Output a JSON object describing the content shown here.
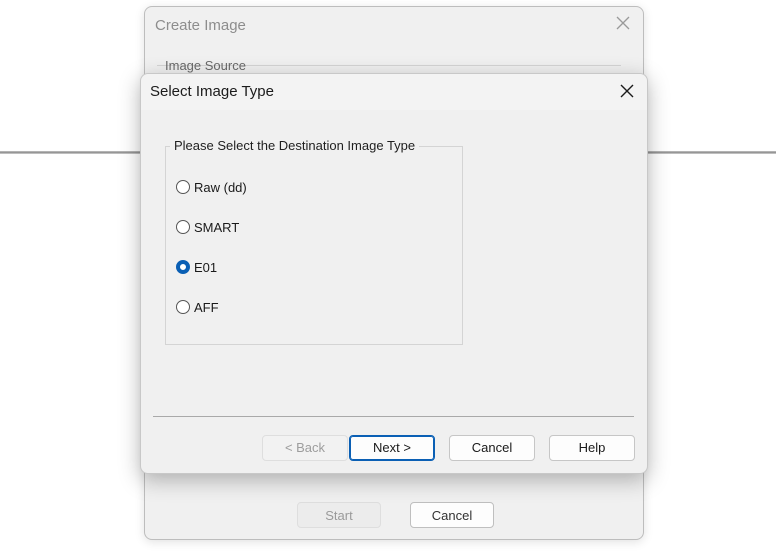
{
  "background_dialog": {
    "title": "Create Image",
    "section_label": "Image Source",
    "start_label": "Start",
    "cancel_label": "Cancel"
  },
  "dialog": {
    "title": "Select Image Type",
    "group_label": "Please Select the Destination Image Type",
    "options": [
      {
        "label": "Raw (dd)",
        "checked": false
      },
      {
        "label": "SMART",
        "checked": false
      },
      {
        "label": "E01",
        "checked": true
      },
      {
        "label": "AFF",
        "checked": false
      }
    ],
    "buttons": {
      "back": "< Back",
      "next": "Next >",
      "cancel": "Cancel",
      "help": "Help"
    }
  },
  "colors": {
    "accent": "#0a5fb4",
    "dialog_bg": "#f0f0f0"
  }
}
